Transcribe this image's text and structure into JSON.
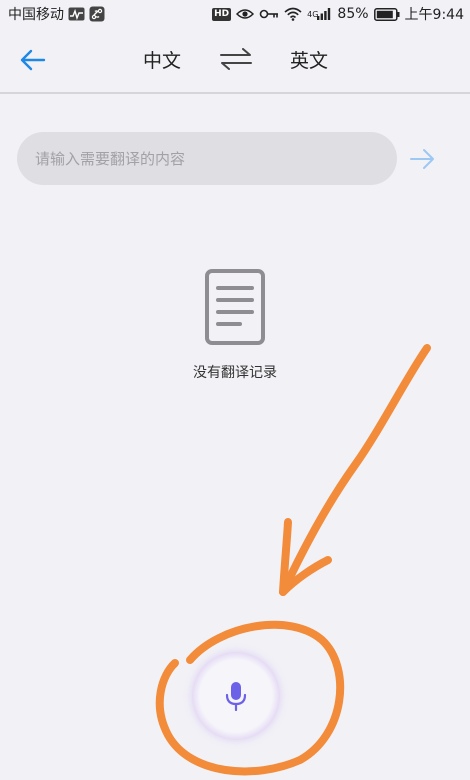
{
  "status_bar": {
    "carrier": "中国移动",
    "lte": "4G",
    "battery": "85%",
    "time": "上午9:44",
    "hd_badge": "HD"
  },
  "header": {
    "source_language": "中文",
    "target_language": "英文"
  },
  "input": {
    "placeholder": "请输入需要翻译的内容",
    "value": ""
  },
  "empty_state": {
    "message": "没有翻译记录"
  },
  "colors": {
    "accent": "#1e88e5",
    "annotation": "#f28b3a",
    "mic": "#6b62e8"
  }
}
